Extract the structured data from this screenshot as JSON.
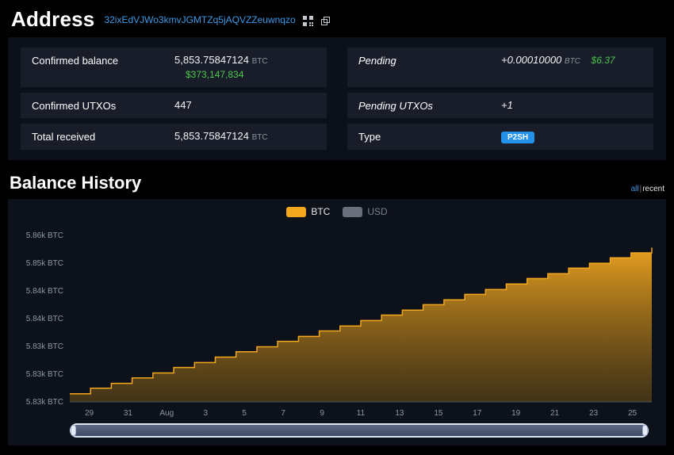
{
  "header": {
    "title": "Address",
    "address": "32ixEdVJWo3kmvJGMTZq5jAQVZZeuwnqzo",
    "icons": [
      "qr-code-icon",
      "copy-icon"
    ]
  },
  "summary": {
    "rows_left": [
      {
        "label": "Confirmed balance",
        "value": "5,853.75847124",
        "unit": "BTC",
        "fiat": "$373,147,834"
      },
      {
        "label": "Confirmed UTXOs",
        "value": "447"
      },
      {
        "label": "Total received",
        "value": "5,853.75847124",
        "unit": "BTC"
      }
    ],
    "rows_right": [
      {
        "label": "Pending",
        "value": "+0.00010000",
        "unit": "BTC",
        "fiat": "$6.37"
      },
      {
        "label": "Pending UTXOs",
        "value": "+1"
      },
      {
        "label": "Type",
        "badge": "P2SH"
      }
    ]
  },
  "balance_history": {
    "title": "Balance History",
    "range": {
      "all": "all",
      "sep": "|",
      "recent": "recent"
    },
    "legend": [
      {
        "label": "BTC",
        "active": true
      },
      {
        "label": "USD",
        "active": false
      }
    ]
  },
  "chart_data": {
    "type": "area",
    "step": "after",
    "title": "Balance History",
    "legend_position": "top",
    "grid": false,
    "ylim": [
      5825.5,
      5856
    ],
    "area_top": "rgba(244,167,31,0.95)",
    "area_bottom": "rgba(110,79,22,0.55)",
    "x": [
      "Jul 29",
      "Jul 30",
      "Jul 31",
      "Aug 1",
      "Aug 2",
      "Aug 3",
      "Aug 4",
      "Aug 5",
      "Aug 6",
      "Aug 7",
      "Aug 8",
      "Aug 9",
      "Aug 10",
      "Aug 11",
      "Aug 12",
      "Aug 13",
      "Aug 14",
      "Aug 15",
      "Aug 16",
      "Aug 17",
      "Aug 18",
      "Aug 19",
      "Aug 20",
      "Aug 21",
      "Aug 22",
      "Aug 23",
      "Aug 24",
      "Aug 25",
      "Aug 26"
    ],
    "series": [
      {
        "name": "BTC",
        "color": "#f2a71f",
        "values": [
          5827.0,
          5828.0,
          5828.9,
          5829.9,
          5830.8,
          5831.8,
          5832.7,
          5833.7,
          5834.7,
          5835.6,
          5836.6,
          5837.5,
          5838.5,
          5839.4,
          5840.4,
          5841.4,
          5842.3,
          5843.3,
          5844.2,
          5845.2,
          5846.1,
          5847.1,
          5848.1,
          5849.0,
          5850.0,
          5850.9,
          5851.9,
          5852.8,
          5853.76
        ]
      },
      {
        "name": "USD",
        "color": "#696f7b",
        "disabled": true,
        "values": []
      }
    ],
    "y_tick_labels": [
      "5.86k BTC",
      "5.85k BTC",
      "5.84k BTC",
      "5.84k BTC",
      "5.83k BTC",
      "5.83k BTC",
      "5.83k BTC"
    ],
    "x_tick_labels": [
      "29",
      "31",
      "Aug",
      "3",
      "5",
      "7",
      "9",
      "11",
      "13",
      "15",
      "17",
      "19",
      "21",
      "23",
      "25"
    ]
  },
  "colors": {
    "accent_blue": "#3d9ae8",
    "green": "#4cc74c",
    "badge_blue": "#2491eb",
    "btc_orange": "#f2a71f",
    "usd_gray": "#696f7b",
    "axis_label": "#8f96a3",
    "axis_line": "#4a5160"
  }
}
